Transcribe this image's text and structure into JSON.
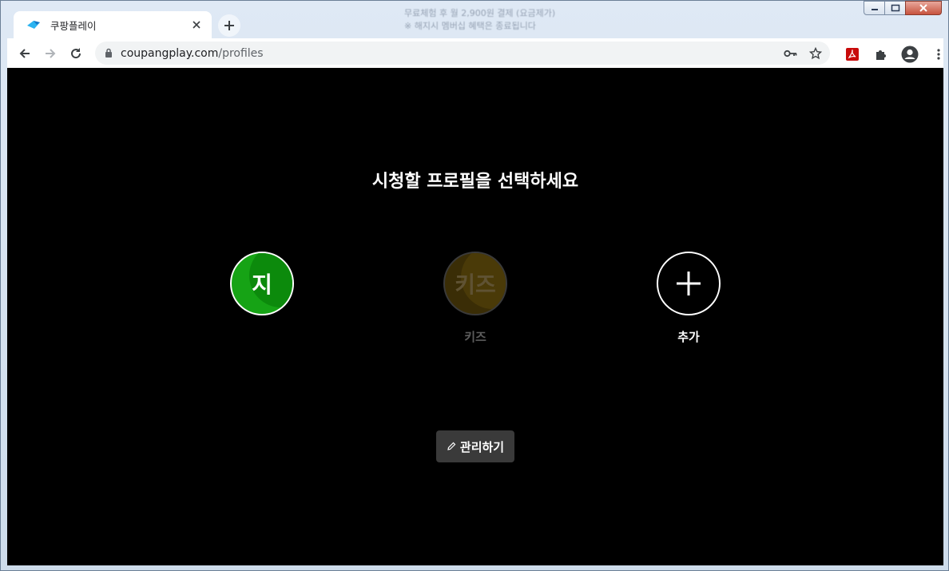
{
  "browser": {
    "tab": {
      "title": "쿠팡플레이",
      "favicon": "coupang-play-icon"
    },
    "background_caption_line1": "무료체험 후 월 2,900원 결제 (요금제가)",
    "background_caption_line2": "※ 해지시 멤버십 혜택은 종료됩니다",
    "address": {
      "domain": "coupangplay.com",
      "path": "/profiles"
    },
    "toolbar_icons": [
      "back-icon",
      "forward-icon",
      "reload-icon",
      "lock-icon",
      "key-icon",
      "star-icon",
      "pdf-extension-icon",
      "extensions-puzzle-icon",
      "profile-avatar-icon",
      "menu-dots-icon"
    ]
  },
  "page": {
    "heading": "시청할 프로필을 선택하세요",
    "profiles": [
      {
        "avatar_text": "지",
        "name": "",
        "color": "#16a315"
      },
      {
        "avatar_text": "키즈",
        "name": "키즈",
        "color": "#4a3a08"
      },
      {
        "avatar_text": "+",
        "name": "추가",
        "color": "#000000"
      }
    ],
    "manage_button": {
      "label": "관리하기",
      "icon": "pencil-icon"
    }
  }
}
